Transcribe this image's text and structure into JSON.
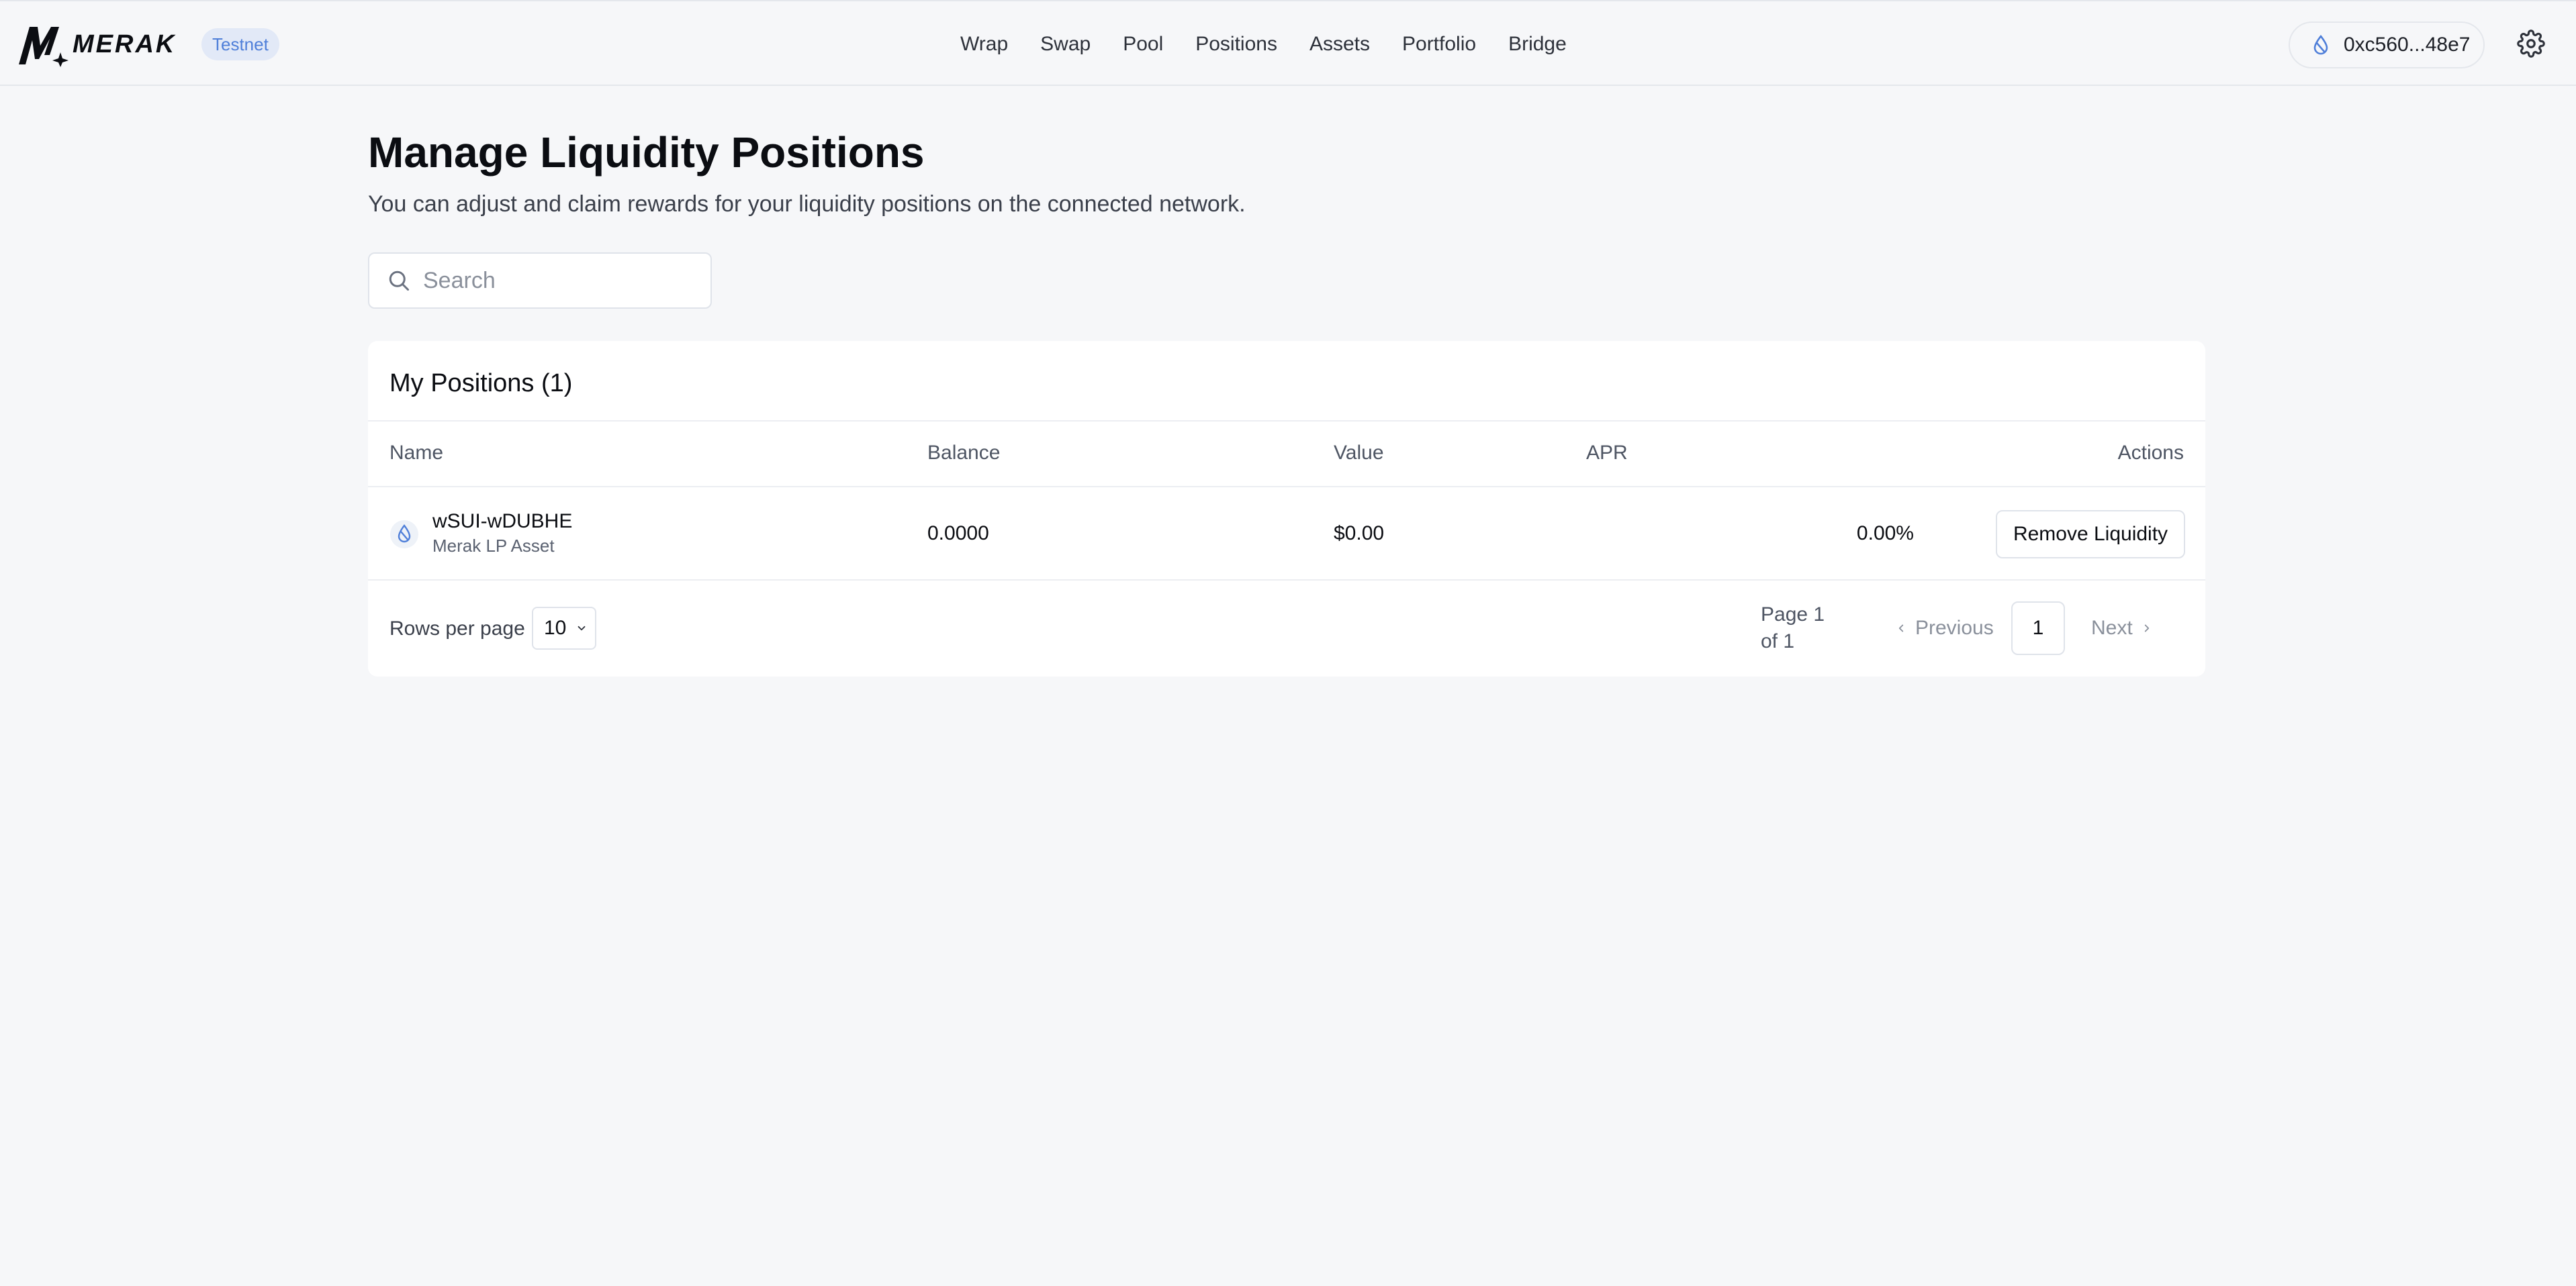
{
  "header": {
    "brand": "MERAK",
    "network_badge": "Testnet",
    "nav": [
      {
        "label": "Wrap"
      },
      {
        "label": "Swap"
      },
      {
        "label": "Pool"
      },
      {
        "label": "Positions"
      },
      {
        "label": "Assets"
      },
      {
        "label": "Portfolio"
      },
      {
        "label": "Bridge"
      }
    ],
    "wallet_address": "0xc560...48e7",
    "icons": {
      "wallet": "water-drop-icon",
      "settings": "gear-icon"
    }
  },
  "page": {
    "title": "Manage Liquidity Positions",
    "subtitle": "You can adjust and claim rewards for your liquidity positions on the connected network."
  },
  "search": {
    "placeholder": "Search",
    "value": ""
  },
  "positions": {
    "title": "My Positions (1)",
    "columns": {
      "name": "Name",
      "balance": "Balance",
      "value": "Value",
      "apr": "APR",
      "actions": "Actions"
    },
    "rows": [
      {
        "name": "wSUI-wDUBHE",
        "subtitle": "Merak LP Asset",
        "balance": "0.0000",
        "value": "$0.00",
        "apr": "0.00%",
        "action": "Remove Liquidity"
      }
    ]
  },
  "pagination": {
    "rows_per_page_label": "Rows per page",
    "rows_per_page": "10",
    "page_info": "Page 1 of 1",
    "previous": "Previous",
    "current_page": "1",
    "next": "Next"
  },
  "colors": {
    "accent": "#4f7fd9",
    "badge_bg": "#e2e9f7",
    "background": "#f6f7f9"
  }
}
